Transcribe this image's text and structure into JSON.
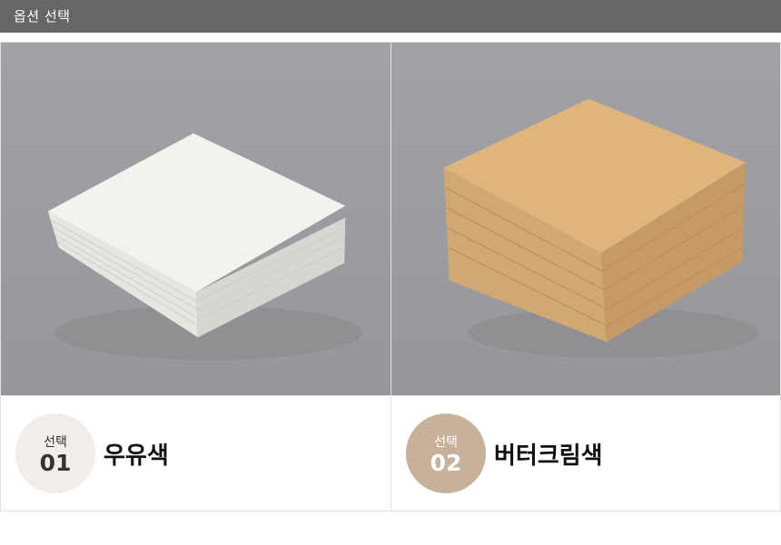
{
  "header": {
    "title": "옵션 선택"
  },
  "options": [
    {
      "badge_label": "선택",
      "number": "01",
      "name": "우유색",
      "color": "#f2f1ec"
    },
    {
      "badge_label": "선택",
      "number": "02",
      "name": "버터크림색",
      "color": "#deb079"
    }
  ],
  "colors": {
    "topbar": "#666666",
    "photo_background": "#9b9c9f",
    "badge1": "#f1eeea",
    "badge2": "#c8b19a"
  }
}
